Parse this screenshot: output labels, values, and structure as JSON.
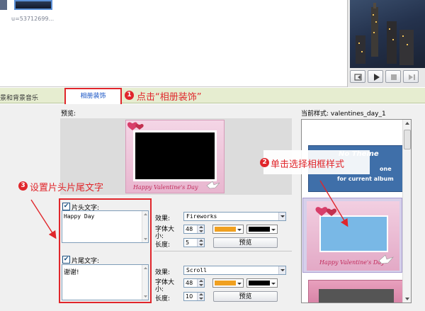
{
  "top": {
    "thumb_caption": "u=53712699...",
    "player_buttons": [
      "frame-step-icon",
      "play-icon",
      "stop-icon",
      "next-icon"
    ]
  },
  "tabs": [
    {
      "label": "景和背景音乐"
    },
    {
      "label": "相册装饰"
    }
  ],
  "annotations": {
    "a1": {
      "num": "1",
      "text": "点击“相册装饰”"
    },
    "a2": {
      "num": "2",
      "text": "单击选择相框样式"
    },
    "a3": {
      "num": "3",
      "text": "设置片头片尾文字"
    }
  },
  "preview": {
    "label": "预览:",
    "frame_caption": "Happy Valentine's Day"
  },
  "current_style": {
    "label": "当前样式: valentines_day_1"
  },
  "styles": {
    "item1_title": "No Theme",
    "item1_sub_a": "one",
    "item1_sub_b": "for current album",
    "item2_caption": "Happy Valentine's Day"
  },
  "head_text": {
    "checkbox_label": "片头文字:",
    "checked": true,
    "value": "Happy Day",
    "effect_label": "效果:",
    "effect_value": "Fireworks",
    "size_label_a": "字体大",
    "size_label_b": "小:",
    "size_value": "48",
    "length_label": "长度:",
    "length_value": "5",
    "preview_button": "预览",
    "text_color": "#f0a020",
    "bg_color": "#000000"
  },
  "tail_text": {
    "checkbox_label": "片尾文字:",
    "checked": true,
    "value": "谢谢!",
    "effect_label": "效果:",
    "effect_value": "Scroll",
    "size_label_a": "字体大",
    "size_label_b": "小:",
    "size_value": "48",
    "length_label": "长度:",
    "length_value": "10",
    "preview_button": "预览",
    "text_color": "#f0a020",
    "bg_color": "#000000"
  },
  "colors": {
    "annotation_red": "#e0262b",
    "tab_bar": "#e6edd0",
    "panel_bg": "#f0f0f0"
  }
}
